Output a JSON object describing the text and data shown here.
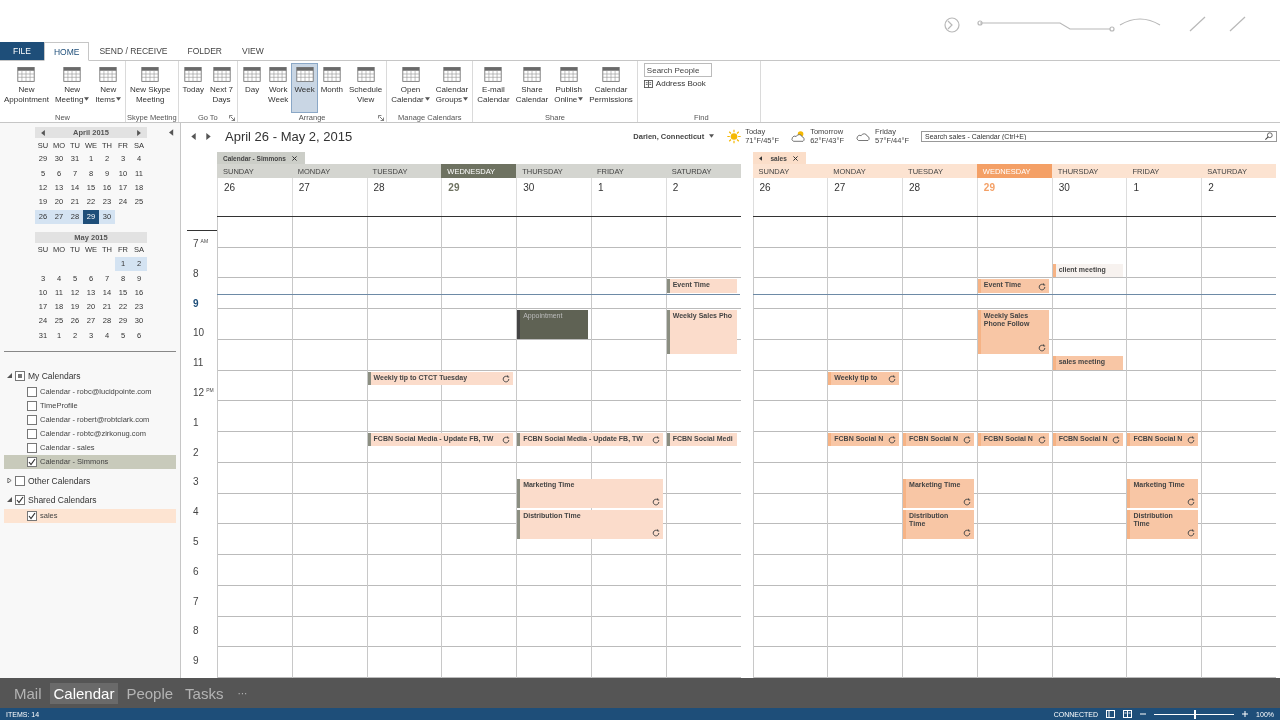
{
  "tabs": [
    {
      "label": "FILE",
      "kind": "file",
      "selected": false
    },
    {
      "label": "HOME",
      "kind": "tab",
      "selected": true
    },
    {
      "label": "SEND / RECEIVE",
      "kind": "tab",
      "selected": false
    },
    {
      "label": "FOLDER",
      "kind": "tab",
      "selected": false
    },
    {
      "label": "VIEW",
      "kind": "tab",
      "selected": false
    }
  ],
  "ribbon": {
    "groups": [
      {
        "name": "New",
        "launcher": false,
        "buttons": [
          {
            "lines": [
              "New",
              "Appointment"
            ],
            "dropdown": false,
            "selected": false
          },
          {
            "lines": [
              "New",
              "Meeting"
            ],
            "dropdown": true,
            "selected": false
          },
          {
            "lines": [
              "New",
              "Items"
            ],
            "dropdown": true,
            "selected": false
          }
        ]
      },
      {
        "name": "Skype Meeting",
        "launcher": false,
        "buttons": [
          {
            "lines": [
              "New Skype",
              "Meeting"
            ],
            "dropdown": false,
            "selected": false
          }
        ]
      },
      {
        "name": "Go To",
        "launcher": true,
        "buttons": [
          {
            "lines": [
              "Today"
            ],
            "dropdown": false,
            "selected": false
          },
          {
            "lines": [
              "Next 7",
              "Days"
            ],
            "dropdown": false,
            "selected": false
          }
        ]
      },
      {
        "name": "Arrange",
        "launcher": true,
        "buttons": [
          {
            "lines": [
              "Day"
            ],
            "dropdown": false,
            "selected": false
          },
          {
            "lines": [
              "Work",
              "Week"
            ],
            "dropdown": false,
            "selected": false
          },
          {
            "lines": [
              "Week"
            ],
            "dropdown": false,
            "selected": true
          },
          {
            "lines": [
              "Month"
            ],
            "dropdown": false,
            "selected": false
          },
          {
            "lines": [
              "Schedule",
              "View"
            ],
            "dropdown": false,
            "selected": false
          }
        ]
      },
      {
        "name": "Manage Calendars",
        "launcher": false,
        "buttons": [
          {
            "lines": [
              "Open",
              "Calendar"
            ],
            "dropdown": true,
            "selected": false
          },
          {
            "lines": [
              "Calendar",
              "Groups"
            ],
            "dropdown": true,
            "selected": false
          }
        ]
      },
      {
        "name": "Share",
        "launcher": false,
        "buttons": [
          {
            "lines": [
              "E-mail",
              "Calendar"
            ],
            "dropdown": false,
            "selected": false
          },
          {
            "lines": [
              "Share",
              "Calendar"
            ],
            "dropdown": false,
            "selected": false
          },
          {
            "lines": [
              "Publish",
              "Online"
            ],
            "dropdown": true,
            "selected": false
          },
          {
            "lines": [
              "Calendar",
              "Permissions"
            ],
            "dropdown": false,
            "selected": false
          }
        ]
      }
    ],
    "find": {
      "name": "Find",
      "search": {
        "placeholder": "Search People"
      },
      "address_book": "Address Book"
    }
  },
  "sidebar": {
    "months": [
      {
        "title": "April 2015",
        "arrows": true,
        "weekdays": [
          "SU",
          "MO",
          "TU",
          "WE",
          "TH",
          "FR",
          "SA"
        ],
        "weeks": [
          {
            "in_view": false,
            "days": [
              {
                "n": "29",
                "selected": false
              },
              {
                "n": "30",
                "selected": false
              },
              {
                "n": "31",
                "selected": false
              },
              {
                "n": "1",
                "selected": false
              },
              {
                "n": "2",
                "selected": false
              },
              {
                "n": "3",
                "selected": false
              },
              {
                "n": "4",
                "selected": false
              }
            ]
          },
          {
            "in_view": false,
            "days": [
              {
                "n": "5",
                "selected": false
              },
              {
                "n": "6",
                "selected": false
              },
              {
                "n": "7",
                "selected": false
              },
              {
                "n": "8",
                "selected": false
              },
              {
                "n": "9",
                "selected": false
              },
              {
                "n": "10",
                "selected": false
              },
              {
                "n": "11",
                "selected": false
              }
            ]
          },
          {
            "in_view": false,
            "days": [
              {
                "n": "12",
                "selected": false
              },
              {
                "n": "13",
                "selected": false
              },
              {
                "n": "14",
                "selected": false
              },
              {
                "n": "15",
                "selected": false
              },
              {
                "n": "16",
                "selected": false
              },
              {
                "n": "17",
                "selected": false
              },
              {
                "n": "18",
                "selected": false
              }
            ]
          },
          {
            "in_view": false,
            "days": [
              {
                "n": "19",
                "selected": false
              },
              {
                "n": "20",
                "selected": false
              },
              {
                "n": "21",
                "selected": false
              },
              {
                "n": "22",
                "selected": false
              },
              {
                "n": "23",
                "selected": false
              },
              {
                "n": "24",
                "selected": false
              },
              {
                "n": "25",
                "selected": false
              }
            ]
          },
          {
            "in_view": true,
            "days": [
              {
                "n": "26",
                "selected": false
              },
              {
                "n": "27",
                "selected": false
              },
              {
                "n": "28",
                "selected": false
              },
              {
                "n": "29",
                "selected": true
              },
              {
                "n": "30",
                "selected": false
              }
            ]
          }
        ]
      },
      {
        "title": "May 2015",
        "arrows": false,
        "weekdays": [
          "SU",
          "MO",
          "TU",
          "WE",
          "TH",
          "FR",
          "SA"
        ],
        "weeks": [
          {
            "in_view": true,
            "days": [
              {
                "n": "1",
                "selected": false
              },
              {
                "n": "2",
                "selected": false
              }
            ]
          },
          {
            "in_view": false,
            "days": [
              {
                "n": "3",
                "selected": false
              },
              {
                "n": "4",
                "selected": false
              },
              {
                "n": "5",
                "selected": false
              },
              {
                "n": "6",
                "selected": false
              },
              {
                "n": "7",
                "selected": false
              },
              {
                "n": "8",
                "selected": false
              },
              {
                "n": "9",
                "selected": false
              }
            ]
          },
          {
            "in_view": false,
            "days": [
              {
                "n": "10",
                "selected": false
              },
              {
                "n": "11",
                "selected": false
              },
              {
                "n": "12",
                "selected": false
              },
              {
                "n": "13",
                "selected": false
              },
              {
                "n": "14",
                "selected": false
              },
              {
                "n": "15",
                "selected": false
              },
              {
                "n": "16",
                "selected": false
              }
            ]
          },
          {
            "in_view": false,
            "days": [
              {
                "n": "17",
                "selected": false
              },
              {
                "n": "18",
                "selected": false
              },
              {
                "n": "19",
                "selected": false
              },
              {
                "n": "20",
                "selected": false
              },
              {
                "n": "21",
                "selected": false
              },
              {
                "n": "22",
                "selected": false
              },
              {
                "n": "23",
                "selected": false
              }
            ]
          },
          {
            "in_view": false,
            "days": [
              {
                "n": "24",
                "selected": false
              },
              {
                "n": "25",
                "selected": false
              },
              {
                "n": "26",
                "selected": false
              },
              {
                "n": "27",
                "selected": false
              },
              {
                "n": "28",
                "selected": false
              },
              {
                "n": "29",
                "selected": false
              },
              {
                "n": "30",
                "selected": false
              }
            ]
          },
          {
            "in_view": false,
            "days": [
              {
                "n": "31",
                "selected": false
              },
              {
                "n": "1",
                "selected": false
              },
              {
                "n": "2",
                "selected": false
              },
              {
                "n": "3",
                "selected": false
              },
              {
                "n": "4",
                "selected": false
              },
              {
                "n": "5",
                "selected": false
              },
              {
                "n": "6",
                "selected": false
              }
            ]
          }
        ]
      }
    ],
    "tree": [
      {
        "label": "My Calendars",
        "expanded": true,
        "checked": true,
        "partial": true,
        "children": [
          {
            "label": "Calendar - robc@lucidpointe.com",
            "checked": false,
            "selected": false
          },
          {
            "label": "TimeProfile",
            "checked": false,
            "selected": false
          },
          {
            "label": "Calendar - robert@robtclark.com",
            "checked": false,
            "selected": false
          },
          {
            "label": "Calendar - robtc@zirkonug.com",
            "checked": false,
            "selected": false
          },
          {
            "label": "Calendar - sales",
            "checked": false,
            "selected": false
          },
          {
            "label": "Calendar - Simmons",
            "checked": true,
            "selected": true,
            "color": "#c8cabb"
          }
        ]
      },
      {
        "label": "Other Calendars",
        "expanded": false,
        "checked": false,
        "partial": false
      },
      {
        "label": "Shared Calendars",
        "expanded": true,
        "checked": true,
        "partial": false,
        "children": [
          {
            "label": "sales",
            "checked": true,
            "selected": true,
            "color": "#fde4d2"
          }
        ]
      }
    ]
  },
  "calendar": {
    "title": "April 26 - May 2, 2015",
    "location": "Darien, Connecticut",
    "weather": [
      {
        "day": "Today",
        "temp": "71°F/45°F",
        "kind": "sunny"
      },
      {
        "day": "Tomorrow",
        "temp": "62°F/43°F",
        "kind": "partly_cloudy"
      },
      {
        "day": "Friday",
        "temp": "57°F/44°F",
        "kind": "cloudy"
      }
    ],
    "search": {
      "placeholder": "Search sales - Calendar (Ctrl+E)"
    },
    "times": [
      {
        "hour": "7",
        "suffix": "AM",
        "current": false
      },
      {
        "hour": "8",
        "current": false
      },
      {
        "hour": "9",
        "current": true
      },
      {
        "hour": "10",
        "current": false
      },
      {
        "hour": "11",
        "current": false
      },
      {
        "hour": "12",
        "suffix": "PM",
        "current": false
      },
      {
        "hour": "1",
        "current": false
      },
      {
        "hour": "2",
        "current": false
      },
      {
        "hour": "3",
        "current": false
      },
      {
        "hour": "4",
        "current": false
      },
      {
        "hour": "5",
        "current": false
      },
      {
        "hour": "6",
        "current": false
      },
      {
        "hour": "7",
        "current": false
      },
      {
        "hour": "8",
        "current": false
      },
      {
        "hour": "9",
        "current": false
      }
    ],
    "panes": [
      {
        "tab": "Calendar - Simmons",
        "back": false,
        "color": "#6e7261",
        "days": [
          {
            "label": "SUNDAY",
            "selected": false
          },
          {
            "label": "MONDAY",
            "selected": false
          },
          {
            "label": "TUESDAY",
            "selected": false
          },
          {
            "label": "WEDNESDAY",
            "selected": true
          },
          {
            "label": "THURSDAY",
            "selected": false
          },
          {
            "label": "FRIDAY",
            "selected": false
          },
          {
            "label": "SATURDAY",
            "selected": false
          }
        ],
        "dates": [
          {
            "n": "26",
            "today": false
          },
          {
            "n": "27",
            "today": false
          },
          {
            "n": "28",
            "today": false
          },
          {
            "n": "29",
            "today": true
          },
          {
            "n": "30",
            "today": false
          },
          {
            "n": "1",
            "today": false
          },
          {
            "n": "2",
            "today": false
          }
        ],
        "events": [
          {
            "title": "Event Time",
            "recurring": false,
            "color": "#fbdccb"
          },
          {
            "title": "Appointment",
            "recurring": false,
            "color": "#5f6254"
          },
          {
            "title": "Weekly Sales Pho",
            "recurring": false,
            "color": "#fbdccb"
          },
          {
            "title": "Weekly tip to CTCT Tuesday",
            "recurring": true,
            "color": "#fbdccb"
          },
          {
            "title": "FCBN Social Media - Update FB, TW",
            "recurring": true,
            "color": "#fbdccb"
          },
          {
            "title": "FCBN Social Media - Update FB, TW",
            "recurring": true,
            "color": "#fbdccb"
          },
          {
            "title": "FCBN Social Medi",
            "recurring": false,
            "color": "#fbdccb"
          },
          {
            "title": "Marketing Time",
            "recurring": true,
            "color": "#fbdccb"
          },
          {
            "title": "Distribution Time",
            "recurring": true,
            "color": "#fbdccb"
          }
        ]
      },
      {
        "tab": "sales",
        "back": true,
        "color": "#f4a066",
        "days": [
          {
            "label": "SUNDAY",
            "selected": false
          },
          {
            "label": "MONDAY",
            "selected": false
          },
          {
            "label": "TUESDAY",
            "selected": false
          },
          {
            "label": "WEDNESDAY",
            "selected": true
          },
          {
            "label": "THURSDAY",
            "selected": false
          },
          {
            "label": "FRIDAY",
            "selected": false
          },
          {
            "label": "SATURDAY",
            "selected": false
          }
        ],
        "dates": [
          {
            "n": "26",
            "today": false
          },
          {
            "n": "27",
            "today": false
          },
          {
            "n": "28",
            "today": false
          },
          {
            "n": "29",
            "today": true
          },
          {
            "n": "30",
            "today": false
          },
          {
            "n": "1",
            "today": false
          },
          {
            "n": "2",
            "today": false
          }
        ],
        "events": [
          {
            "title": "client meeting",
            "recurring": false,
            "color": "#f7f2ef"
          },
          {
            "title": "Event Time",
            "recurring": true,
            "color": "#f8c6a5"
          },
          {
            "title": "Weekly Sales Phone Follow",
            "recurring": true,
            "color": "#f8c6a5"
          },
          {
            "title": "sales meeting",
            "recurring": false,
            "color": "#f8c6a5"
          },
          {
            "title": "Weekly tip to",
            "recurring": true,
            "color": "#f8c6a5"
          },
          {
            "title": "FCBN Social N",
            "recurring": true,
            "color": "#f8c6a5"
          },
          {
            "title": "FCBN Social N",
            "recurring": true,
            "color": "#f8c6a5"
          },
          {
            "title": "FCBN Social N",
            "recurring": true,
            "color": "#f8c6a5"
          },
          {
            "title": "FCBN Social N",
            "recurring": true,
            "color": "#f8c6a5"
          },
          {
            "title": "FCBN Social N",
            "recurring": true,
            "color": "#f8c6a5"
          },
          {
            "title": "Marketing Time",
            "recurring": true,
            "color": "#f8c6a5"
          },
          {
            "title": "Distribution Time",
            "recurring": true,
            "color": "#f8c6a5"
          },
          {
            "title": "Marketing Time",
            "recurring": true,
            "color": "#f8c6a5"
          },
          {
            "title": "Distribution Time",
            "recurring": true,
            "color": "#f8c6a5"
          }
        ]
      }
    ]
  },
  "nav": {
    "items": [
      {
        "label": "Mail",
        "selected": false
      },
      {
        "label": "Calendar",
        "selected": true
      },
      {
        "label": "People",
        "selected": false
      },
      {
        "label": "Tasks",
        "selected": false
      }
    ],
    "more": "···"
  },
  "status": {
    "items": "ITEMS: 14",
    "connection": "CONNECTED",
    "zoom": "100%",
    "zoom_slider": {
      "level": 0.5
    }
  }
}
